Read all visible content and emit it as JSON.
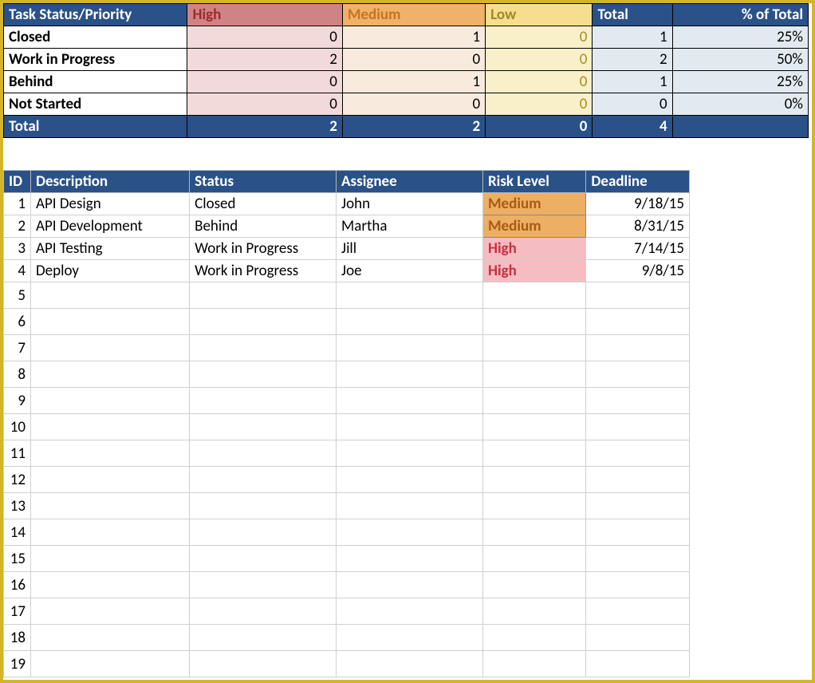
{
  "summary": {
    "header": {
      "label": "Task Status/Priority",
      "high": "High",
      "medium": "Medium",
      "low": "Low",
      "total": "Total",
      "pct": "% of Total"
    },
    "rows": [
      {
        "label": "Closed",
        "high": 0,
        "medium": 1,
        "low": 0,
        "total": 1,
        "pct": "25%"
      },
      {
        "label": "Work in Progress",
        "high": 2,
        "medium": 0,
        "low": 0,
        "total": 2,
        "pct": "50%"
      },
      {
        "label": "Behind",
        "high": 0,
        "medium": 1,
        "low": 0,
        "total": 1,
        "pct": "25%"
      },
      {
        "label": "Not Started",
        "high": 0,
        "medium": 0,
        "low": 0,
        "total": 0,
        "pct": "0%"
      }
    ],
    "totals": {
      "label": "Total",
      "high": 2,
      "medium": 2,
      "low": 0,
      "total": 4,
      "pct": ""
    }
  },
  "tasks": {
    "header": {
      "id": "ID",
      "description": "Description",
      "status": "Status",
      "assignee": "Assignee",
      "risk": "Risk Level",
      "deadline": "Deadline"
    },
    "rows": [
      {
        "id": 1,
        "description": "API Design",
        "status": "Closed",
        "assignee": "John",
        "risk": "Medium",
        "risk_class": "risk-medium",
        "deadline": "9/18/15"
      },
      {
        "id": 2,
        "description": "API Development",
        "status": "Behind",
        "assignee": "Martha",
        "risk": "Medium",
        "risk_class": "risk-medium",
        "deadline": "8/31/15"
      },
      {
        "id": 3,
        "description": "API Testing",
        "status": "Work in Progress",
        "assignee": "Jill",
        "risk": "High",
        "risk_class": "risk-high",
        "deadline": "7/14/15"
      },
      {
        "id": 4,
        "description": "Deploy",
        "status": "Work in Progress",
        "assignee": "Joe",
        "risk": "High",
        "risk_class": "risk-high",
        "deadline": "9/8/15"
      }
    ],
    "empty_row_ids": [
      5,
      6,
      7,
      8,
      9,
      10,
      11,
      12,
      13,
      14,
      15,
      16,
      17,
      18,
      19
    ]
  }
}
